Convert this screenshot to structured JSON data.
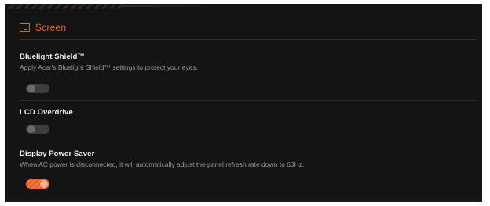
{
  "header": {
    "title": "Screen",
    "icon": "screen-icon",
    "accent_color": "#e8622a"
  },
  "settings": [
    {
      "title": "Bluelight Shield™",
      "description": "Apply Acer's Bluelight Shield™ settings to protect your eyes.",
      "enabled": false
    },
    {
      "title": "LCD Overdrive",
      "description": "",
      "enabled": false
    },
    {
      "title": "Display Power Saver",
      "description": "When AC power is disconnected, it will automatically adjust the panel refresh rate down to 60Hz.",
      "enabled": true
    }
  ]
}
